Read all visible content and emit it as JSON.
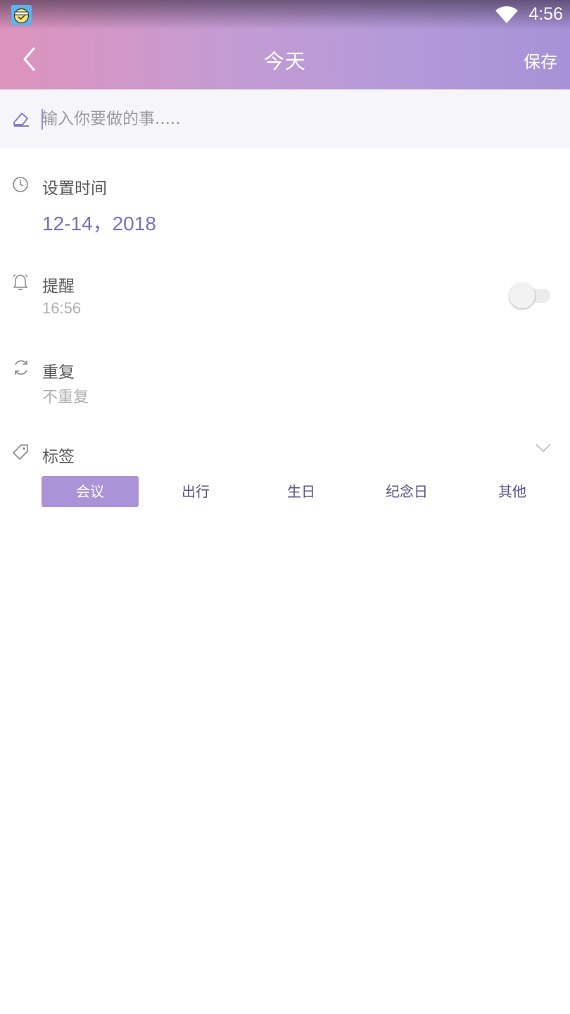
{
  "status_bar": {
    "time": "4:56"
  },
  "nav": {
    "title": "今天",
    "save_label": "保存"
  },
  "todo": {
    "placeholder": "输入你要做的事....."
  },
  "time_section": {
    "label": "设置时间",
    "date": "12-14，2018"
  },
  "reminder": {
    "label": "提醒",
    "time": "16:56",
    "enabled": false
  },
  "repeat": {
    "label": "重复",
    "value": "不重复"
  },
  "tags": {
    "label": "标签",
    "options": [
      "会议",
      "出行",
      "生日",
      "纪念日",
      "其他"
    ],
    "selected": "会议"
  },
  "colors": {
    "accent": "#ab93d8",
    "date_text": "#7b6fc0",
    "header_start": "#dd93bc",
    "header_end": "#a692d6"
  }
}
